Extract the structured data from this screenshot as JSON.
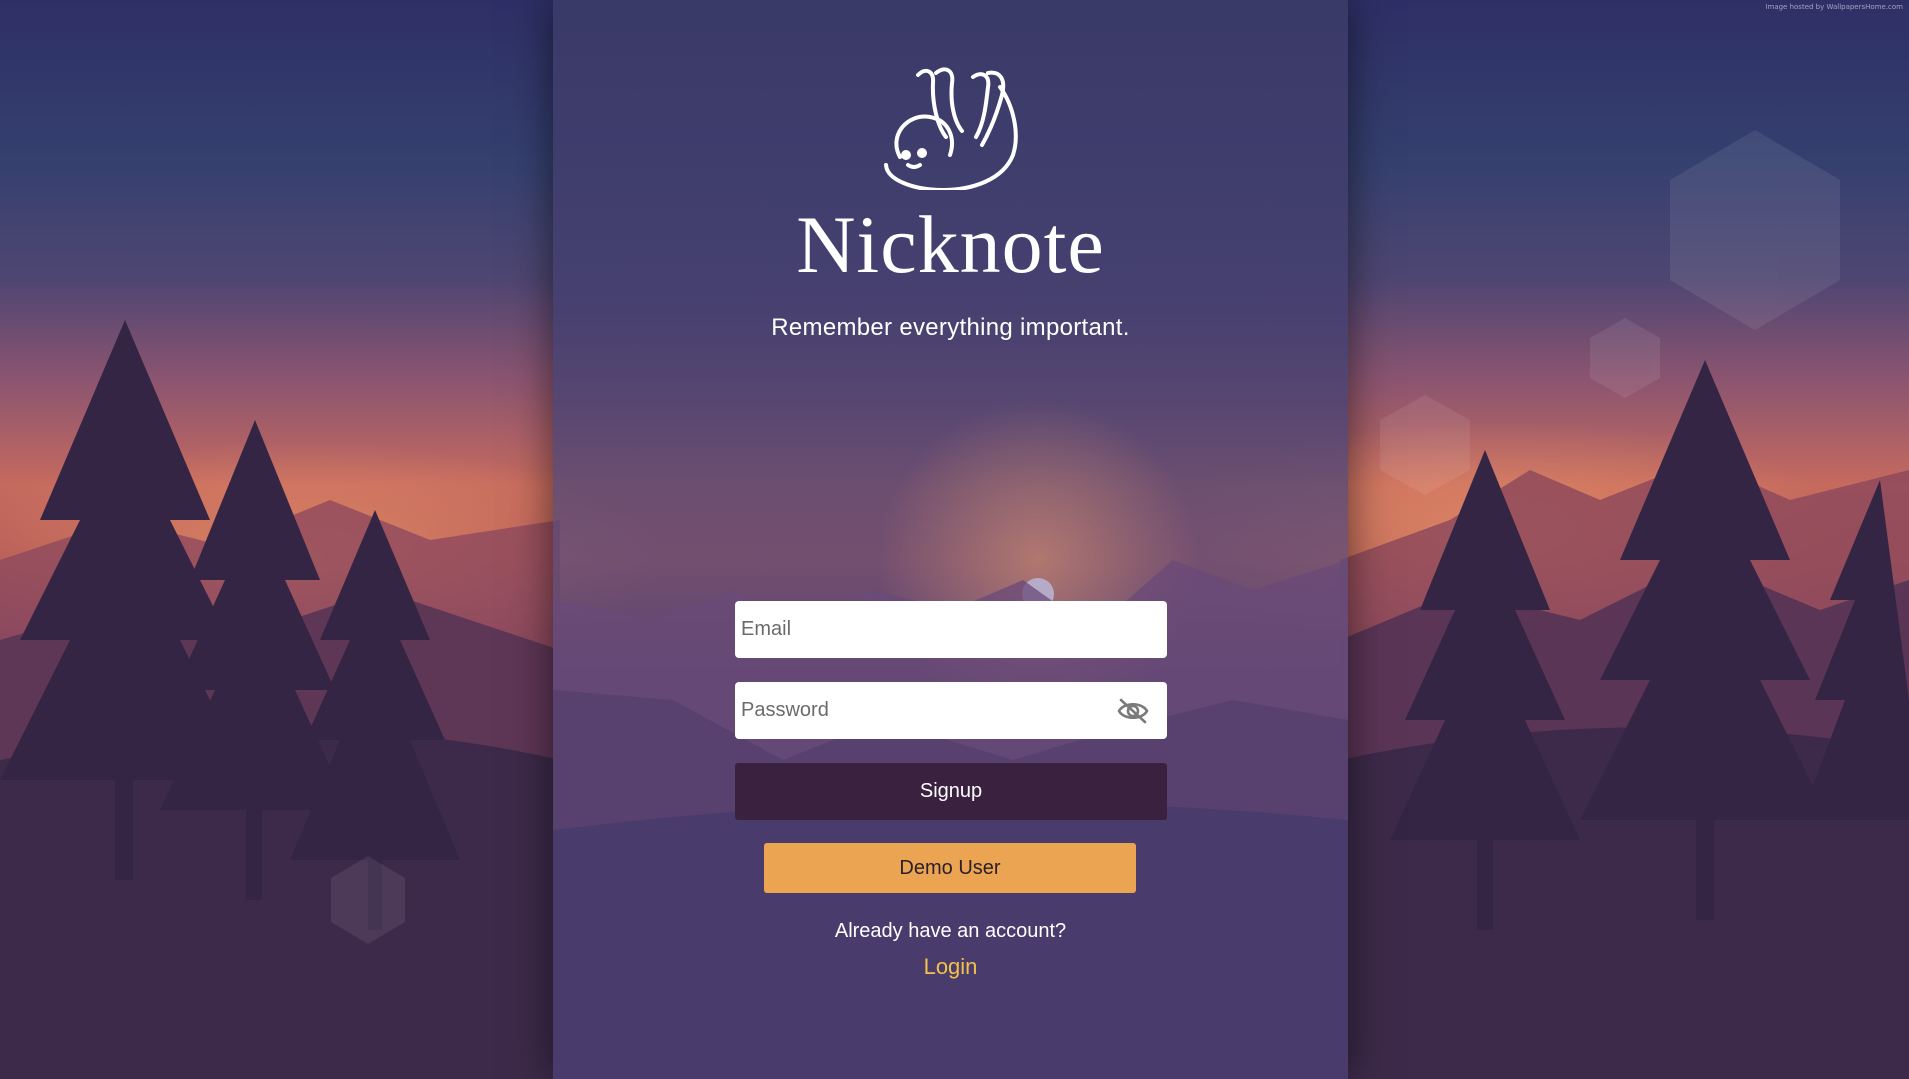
{
  "hosted_note": "Image hosted by WallpapersHome.com",
  "brand": {
    "name": "Nicknote",
    "tagline": "Remember everything important.",
    "logo_icon": "sloth-icon"
  },
  "form": {
    "email_placeholder": "Email",
    "password_placeholder": "Password",
    "password_toggle_icon": "eye-slash-icon",
    "signup_label": "Signup",
    "demo_label": "Demo User",
    "account_prompt": "Already have an account?",
    "login_label": "Login"
  },
  "colors": {
    "signup_button": "#3a213f",
    "demo_button": "#eaa452",
    "login_link": "#f2c14a",
    "panel": "#3e3a69"
  }
}
